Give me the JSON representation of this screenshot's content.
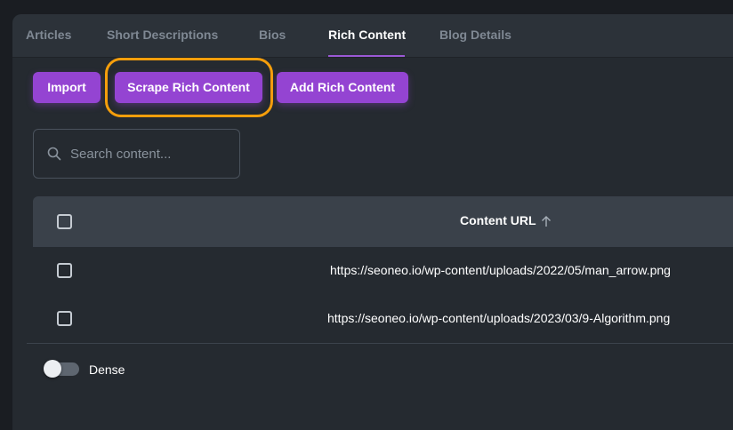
{
  "tabs": [
    {
      "label": "Articles"
    },
    {
      "label": "Short Descriptions"
    },
    {
      "label": "Bios"
    },
    {
      "label": "Rich Content"
    },
    {
      "label": "Blog Details"
    }
  ],
  "active_tab": "Rich Content",
  "toolbar": {
    "import_label": "Import",
    "scrape_label": "Scrape Rich Content",
    "add_label": "Add Rich Content"
  },
  "search": {
    "placeholder": "Search content...",
    "value": ""
  },
  "table": {
    "columns": [
      {
        "label": "Content URL",
        "sort": "ascending"
      }
    ],
    "rows": [
      {
        "url": "https://seoneo.io/wp-content/uploads/2022/05/man_arrow.png"
      },
      {
        "url": "https://seoneo.io/wp-content/uploads/2023/03/9-Algorithm.png"
      }
    ]
  },
  "dense": {
    "label": "Dense",
    "enabled": false
  },
  "colors": {
    "accent": "#9444d2",
    "highlight": "#f59e0b",
    "background": "#252a30",
    "header": "#3a414a"
  }
}
